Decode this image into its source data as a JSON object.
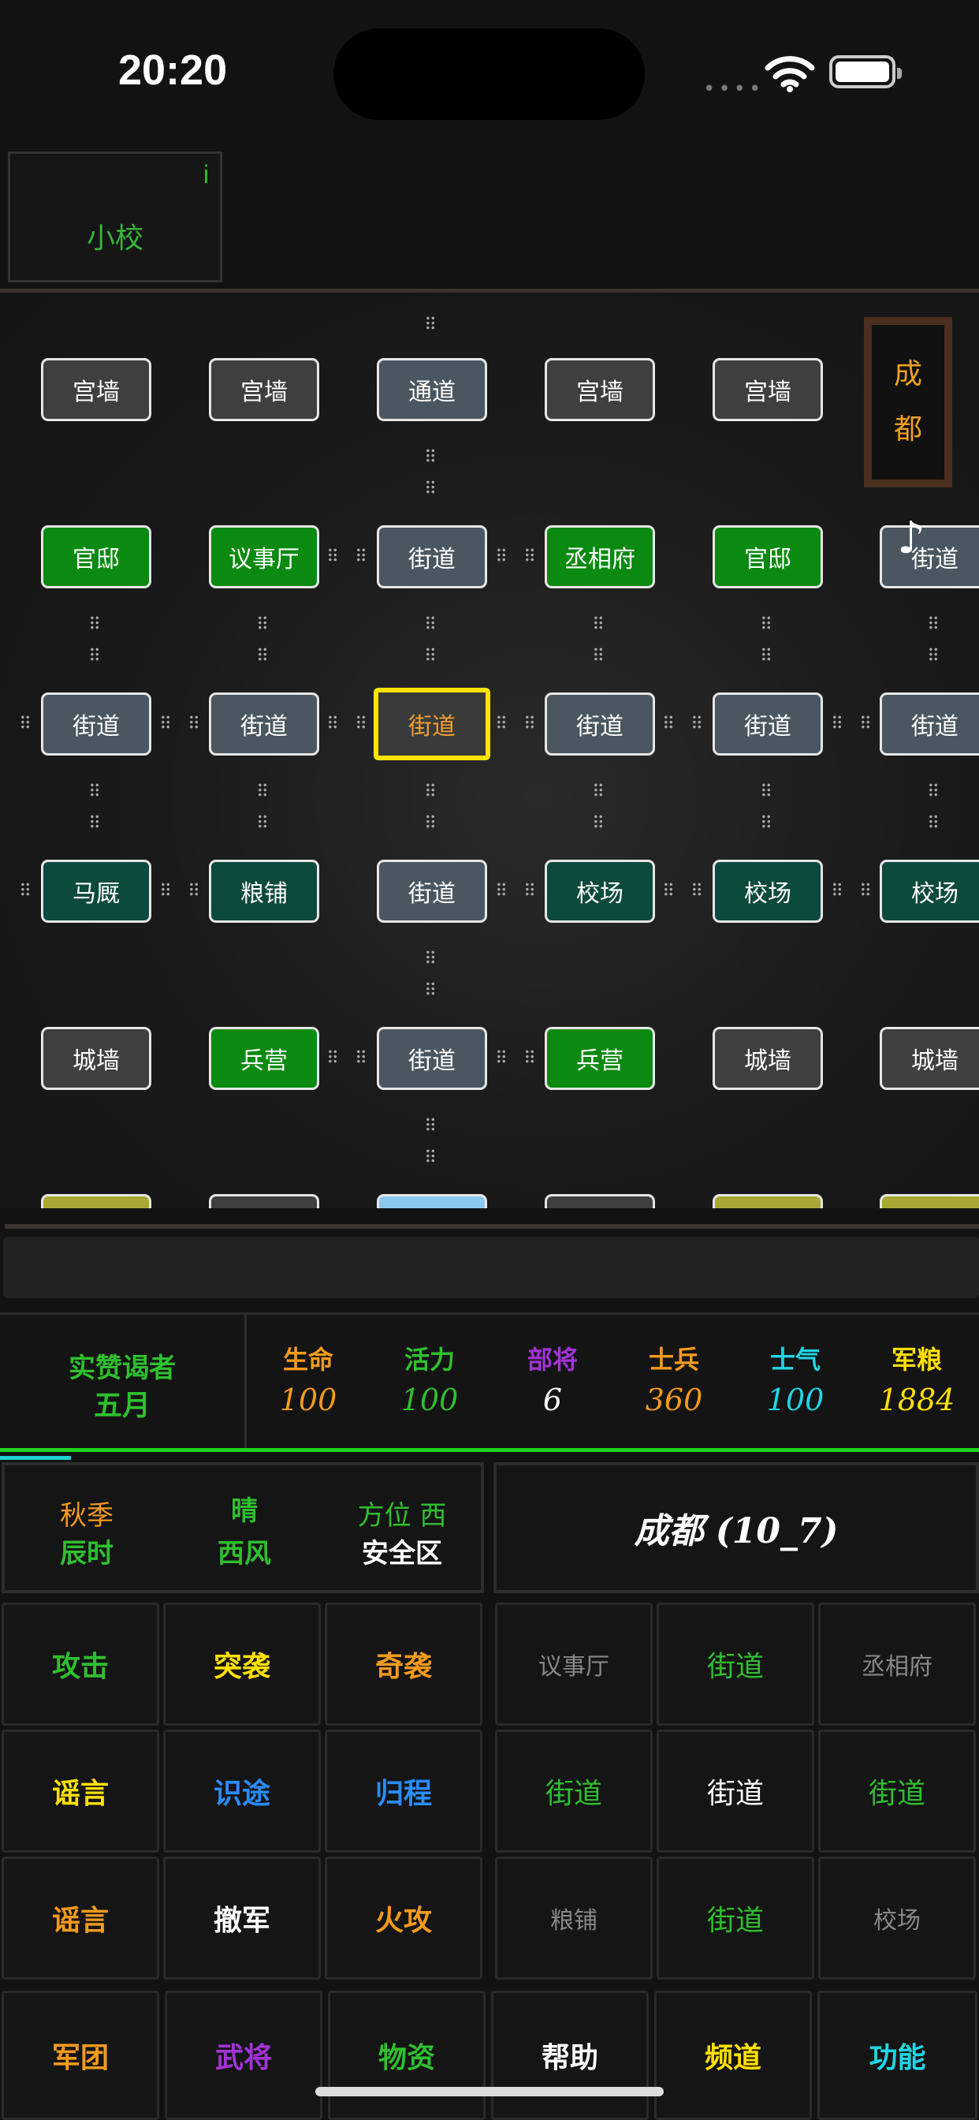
{
  "status": {
    "time": "20:20"
  },
  "rank_box": {
    "info_icon": "i",
    "rank": "小校"
  },
  "map": {
    "rows": [
      [
        "宫墙",
        "宫墙",
        "通道",
        "宫墙",
        "宫墙"
      ],
      [
        "官邸",
        "议事厅",
        "街道",
        "丞相府",
        "官邸",
        "街道"
      ],
      [
        "街道",
        "街道",
        "街道",
        "街道",
        "街道",
        "街道"
      ],
      [
        "马厩",
        "粮铺",
        "街道",
        "校场",
        "校场",
        "校场"
      ],
      [
        "城墙",
        "兵营",
        "街道",
        "兵营",
        "城墙",
        "城墙"
      ]
    ],
    "city_label_1": "成",
    "city_label_2": "都",
    "music_icon": "♪",
    "connector": "⠿"
  },
  "player": {
    "title": "实赞谒者",
    "month": "五月"
  },
  "stats": {
    "hp_label": "生命",
    "hp": "100",
    "energy_label": "活力",
    "energy": "100",
    "generals_label": "部将",
    "generals": "6",
    "soldiers_label": "士兵",
    "soldiers": "360",
    "morale_label": "士气",
    "morale": "100",
    "food_label": "军粮",
    "food": "1884"
  },
  "info": {
    "season": "秋季",
    "weather": "晴",
    "direction": "方位 西",
    "hour": "辰时",
    "wind": "西风",
    "zone": "安全区"
  },
  "location": "成都 (10_7)",
  "actions": {
    "attack": "攻击",
    "raid": "突袭",
    "ambush": "奇袭",
    "rumor": "谣言",
    "lost_way": "识途",
    "return": "归程",
    "rumor2": "谣言",
    "retreat": "撤军",
    "fire_attack": "火攻"
  },
  "nearby": {
    "nw": "议事厅",
    "n": "街道",
    "ne": "丞相府",
    "w": "街道",
    "c": "街道",
    "e": "街道",
    "sw": "粮铺",
    "s": "街道",
    "se": "校场"
  },
  "menu": {
    "legion": "军团",
    "generals": "武将",
    "supplies": "物资",
    "help": "帮助",
    "channel": "频道",
    "function": "功能"
  },
  "colors": {
    "green_text": "#2fbf2f",
    "yellow_text": "#ffe000",
    "orange_text": "#f39a1e",
    "blue_text": "#2a8cff",
    "purple_text": "#a233d6",
    "cyan_text": "#20d6e6",
    "selected_border": "#ffe400"
  }
}
